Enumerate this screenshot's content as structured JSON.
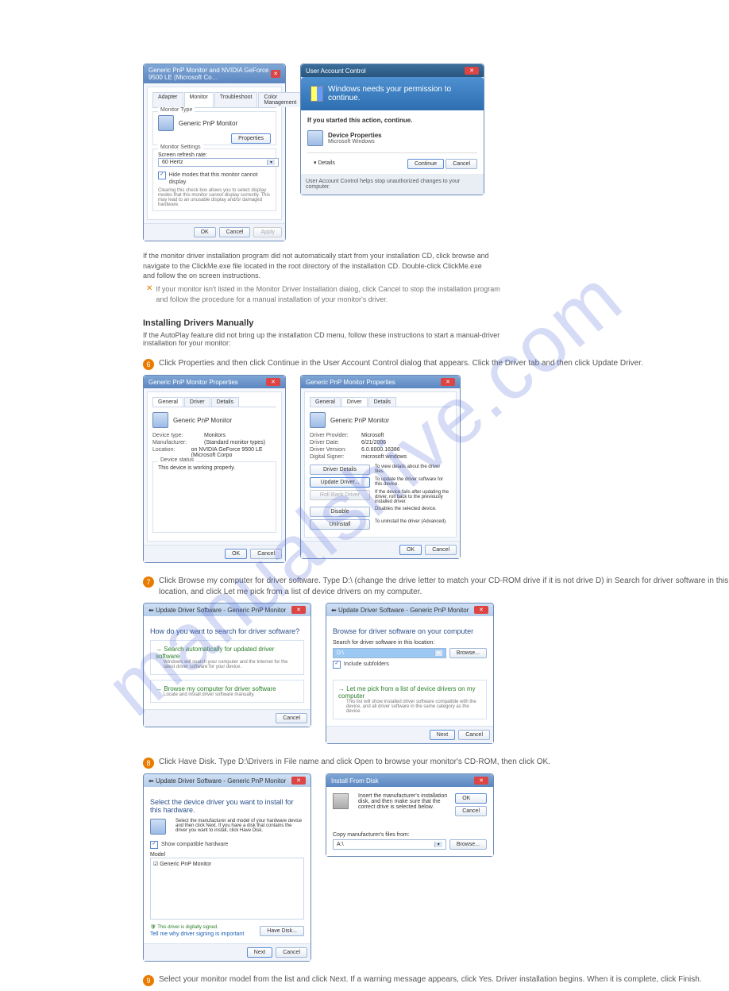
{
  "watermark": "manualshive.com",
  "d1": {
    "title": "Generic PnP Monitor and NVIDIA GeForce 9500 LE (Microsoft Co…",
    "tabs": [
      "Adapter",
      "Monitor",
      "Troubleshoot",
      "Color Management"
    ],
    "group1_label": "Monitor Type",
    "monitor_name": "Generic PnP Monitor",
    "properties_btn": "Properties",
    "group2_label": "Monitor Settings",
    "refresh_label": "Screen refresh rate:",
    "refresh_value": "60 Hertz",
    "check_label": "Hide modes that this monitor cannot display",
    "check_desc": "Clearing this check box allows you to select display modes that this monitor cannot display correctly. This may lead to an unusable display and/or damaged hardware.",
    "ok": "OK",
    "cancel": "Cancel",
    "apply": "Apply"
  },
  "d2": {
    "title": "User Account Control",
    "heading": "Windows needs your permission to continue.",
    "started": "If you started this action, continue.",
    "app": "Device Properties",
    "vendor": "Microsoft Windows",
    "details": "Details",
    "continue": "Continue",
    "cancel": "Cancel",
    "footer": "User Account Control helps stop unauthorized changes to your computer."
  },
  "row_note_5b": {
    "text": "If the monitor driver installation program did not automatically start from your installation CD, click browse and navigate to the ClickMe.exe file located in the root directory of the installation CD. Double-click ClickMe.exe and follow the on screen instructions.",
    "footnote": "If your monitor isn't listed in the Monitor Driver Installation dialog, click Cancel to stop the installation program and follow the procedure for a manual installation of your monitor's driver."
  },
  "instr_heading": "Installing Drivers Manually",
  "instr_text": "If the AutoPlay feature did not bring up the installation CD menu, follow these instructions to start a manual-driver installation for your monitor:",
  "step6": {
    "num": "6",
    "text": "Click Properties and then click Continue in the User Account Control dialog that appears. Click the Driver tab and then click Update Driver.",
    "d3": {
      "title": "Generic PnP Monitor Properties",
      "tabs": [
        "General",
        "Driver",
        "Details"
      ],
      "monitor": "Generic PnP Monitor",
      "rows": [
        {
          "lbl": "Device type:",
          "val": "Monitors"
        },
        {
          "lbl": "Manufacturer:",
          "val": "(Standard monitor types)"
        },
        {
          "lbl": "Location:",
          "val": "on NVIDIA GeForce 9500 LE (Microsoft Corpo"
        }
      ],
      "status_label": "Device status",
      "status_text": "This device is working properly.",
      "ok": "OK",
      "cancel": "Cancel"
    },
    "d4": {
      "title": "Generic PnP Monitor Properties",
      "tabs": [
        "General",
        "Driver",
        "Details"
      ],
      "monitor": "Generic PnP Monitor",
      "rows": [
        {
          "lbl": "Driver Provider:",
          "val": "Microsoft"
        },
        {
          "lbl": "Driver Date:",
          "val": "6/21/2006"
        },
        {
          "lbl": "Driver Version:",
          "val": "6.0.6000.16386"
        },
        {
          "lbl": "Digital Signer:",
          "val": "microsoft windows"
        }
      ],
      "buttons": [
        {
          "label": "Driver Details",
          "desc": "To view details about the driver files."
        },
        {
          "label": "Update Driver...",
          "desc": "To update the driver software for this device.",
          "hi": true
        },
        {
          "label": "Roll Back Driver",
          "desc": "If the device fails after updating the driver, roll back to the previously installed driver.",
          "disabled": true
        },
        {
          "label": "Disable",
          "desc": "Disables the selected device."
        },
        {
          "label": "Uninstall",
          "desc": "To uninstall the driver (Advanced)."
        }
      ],
      "ok": "OK",
      "cancel": "Cancel"
    }
  },
  "step7": {
    "num": "7",
    "text": "Click Browse my computer for driver software. Type D:\\ (change the drive letter to match your CD-ROM drive if it is not drive D) in Search for driver software in this location, and click Let me pick from a list of device drivers on my computer.",
    "d5": {
      "title": "Update Driver Software - Generic PnP Monitor",
      "question": "How do you want to search for driver software?",
      "opt1": "Search automatically for updated driver software",
      "opt1_desc": "Windows will search your computer and the Internet for the latest driver software for your device.",
      "opt2": "Browse my computer for driver software",
      "opt2_desc": "Locate and install driver software manually.",
      "cancel": "Cancel"
    },
    "d6": {
      "title": "Update Driver Software - Generic PnP Monitor",
      "heading": "Browse for driver software on your computer",
      "search_label": "Search for driver software in this location:",
      "path": "D:\\",
      "browse": "Browse...",
      "include": "Include subfolders",
      "pick": "Let me pick from a list of device drivers on my computer",
      "pick_desc": "This list will show installed driver software compatible with the device, and all driver software in the same category as the device.",
      "next": "Next",
      "cancel": "Cancel"
    }
  },
  "step8": {
    "num": "8",
    "text": "Click Have Disk. Type D:\\Drivers in File name and click Open to browse your monitor's CD-ROM, then click OK.",
    "d7": {
      "title": "Update Driver Software - Generic PnP Monitor",
      "heading": "Select the device driver you want to install for this hardware.",
      "subtext": "Select the manufacturer and model of your hardware device and then click Next. If you have a disk that contains the driver you want to install, click Have Disk.",
      "show_compat": "Show compatible hardware",
      "model_label": "Model",
      "model_value": "Generic PnP Monitor",
      "signed": "This driver is digitally signed.",
      "tell_me": "Tell me why driver signing is important",
      "have_disk": "Have Disk...",
      "next": "Next",
      "cancel": "Cancel"
    },
    "d8": {
      "title": "Install From Disk",
      "text": "Insert the manufacturer's installation disk, and then make sure that the correct drive is selected below.",
      "ok": "OK",
      "cancel": "Cancel",
      "copy_label": "Copy manufacturer's files from:",
      "path": "A:\\",
      "browse": "Browse..."
    }
  },
  "step9": {
    "num": "9",
    "text": "Select your monitor model from the list and click Next. If a warning message appears, click Yes. Driver installation begins. When it is complete, click Finish."
  }
}
